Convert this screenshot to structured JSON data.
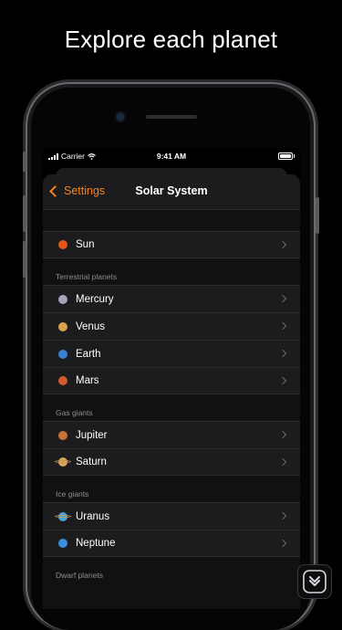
{
  "headline": "Explore each planet",
  "status_bar": {
    "carrier": "Carrier",
    "time": "9:41 AM"
  },
  "navbar": {
    "back_label": "Settings",
    "title": "Solar System"
  },
  "colors": {
    "accent": "#f7831e",
    "background": "#000000",
    "cell": "#1c1c1e",
    "secondary_text": "#8e8e93"
  },
  "sections": [
    {
      "header": "",
      "items": [
        {
          "label": "Sun",
          "icon": "sun-icon",
          "color": "#e3561c"
        }
      ]
    },
    {
      "header": "Terrestrial planets",
      "items": [
        {
          "label": "Mercury",
          "icon": "mercury-icon",
          "color": "#a9a3b8"
        },
        {
          "label": "Venus",
          "icon": "venus-icon",
          "color": "#d9a24a"
        },
        {
          "label": "Earth",
          "icon": "earth-icon",
          "color": "#3a7fd0"
        },
        {
          "label": "Mars",
          "icon": "mars-icon",
          "color": "#d35a2a"
        }
      ]
    },
    {
      "header": "Gas giants",
      "items": [
        {
          "label": "Jupiter",
          "icon": "jupiter-icon",
          "color": "#c9733a"
        },
        {
          "label": "Saturn",
          "icon": "saturn-icon",
          "color": "#d9a35a"
        }
      ]
    },
    {
      "header": "Ice giants",
      "items": [
        {
          "label": "Uranus",
          "icon": "uranus-icon",
          "color": "#4aa3d8"
        },
        {
          "label": "Neptune",
          "icon": "neptune-icon",
          "color": "#3a8fe0"
        }
      ]
    },
    {
      "header": "Dwarf planets",
      "items": []
    }
  ]
}
